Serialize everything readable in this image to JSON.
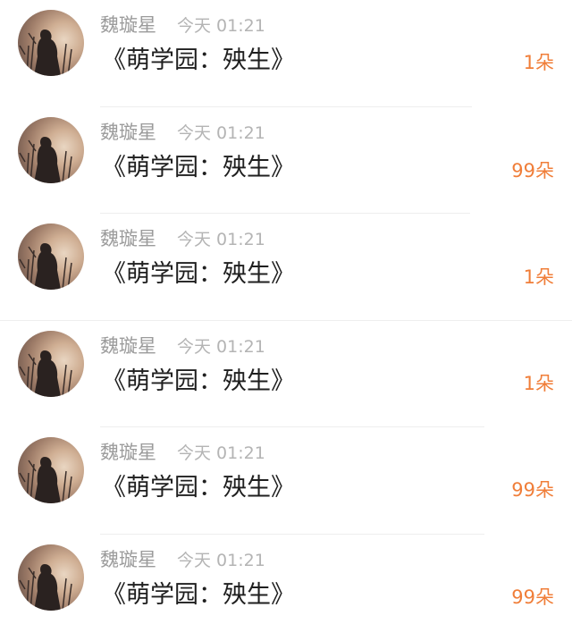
{
  "items": [
    {
      "name": "魏璇星",
      "time": "今天 01:21",
      "title": "《萌学园：殃生》",
      "count": "1朵"
    },
    {
      "name": "魏璇星",
      "time": "今天 01:21",
      "title": "《萌学园：殃生》",
      "count": "99朵"
    },
    {
      "name": "魏璇星",
      "time": "今天 01:21",
      "title": "《萌学园：殃生》",
      "count": "1朵"
    },
    {
      "name": "魏璇星",
      "time": "今天 01:21",
      "title": "《萌学园：殃生》",
      "count": "1朵"
    },
    {
      "name": "魏璇星",
      "time": "今天 01:21",
      "title": "《萌学园：殃生》",
      "count": "99朵"
    },
    {
      "name": "魏璇星",
      "time": "今天 01:21",
      "title": "《萌学园：殃生》",
      "count": "99朵"
    }
  ],
  "colors": {
    "count": "#f07e39",
    "name": "#9b9b9b",
    "time": "#b4b4b4",
    "title": "#1f1f1f"
  }
}
